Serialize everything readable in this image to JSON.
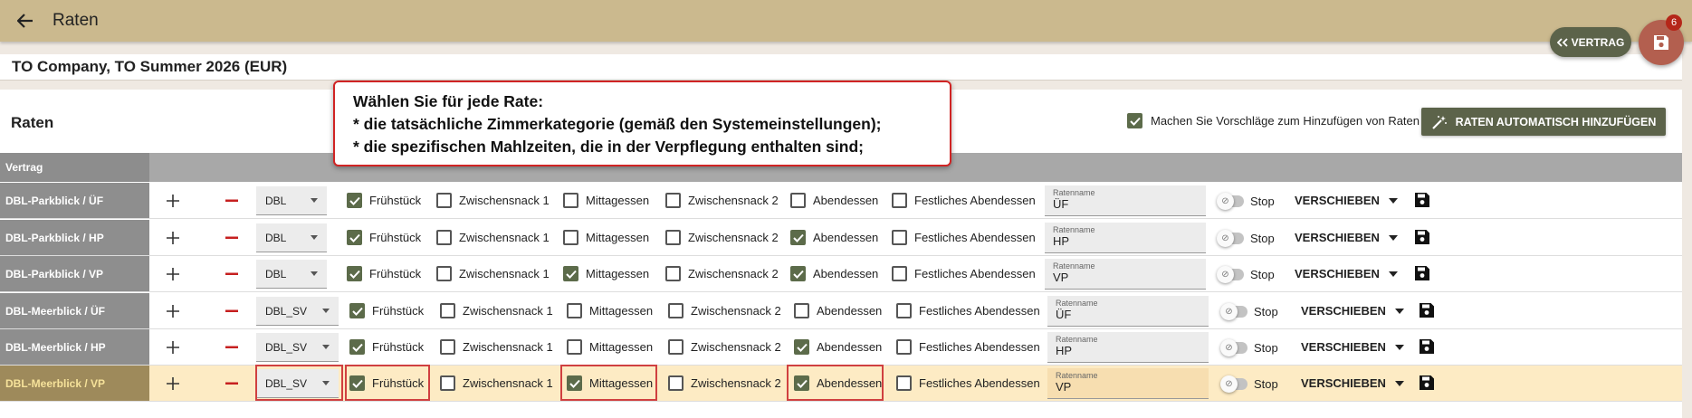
{
  "app": {
    "title": "Raten"
  },
  "contract": {
    "title": "TO Company, TO Summer 2026 (EUR)"
  },
  "fab": {
    "vertrag_label": "VERTRAG",
    "save_badge": "6"
  },
  "section": {
    "title": "Raten",
    "suggest_label": "Machen Sie Vorschläge zum Hinzufügen von Raten",
    "suggest_checked": true,
    "auto_add_label": "RATEN AUTOMATISCH HINZUFÜGEN"
  },
  "table": {
    "header_vertrag": "Vertrag",
    "name_field_label": "Ratenname",
    "stop_label": "Stop",
    "move_label": "VERSCHIEBEN",
    "meal_labels": [
      "Frühstück",
      "Zwischensnack 1",
      "Mittagessen",
      "Zwischensnack 2",
      "Abendessen",
      "Festliches Abendessen"
    ],
    "rows": [
      {
        "label": "DBL-Parkblick / ÜF",
        "room": "DBL",
        "meals": [
          true,
          false,
          false,
          false,
          false,
          false
        ],
        "name": "ÜF",
        "selected": false
      },
      {
        "label": "DBL-Parkblick / HP",
        "room": "DBL",
        "meals": [
          true,
          false,
          false,
          false,
          true,
          false
        ],
        "name": "HP",
        "selected": false
      },
      {
        "label": "DBL-Parkblick / VP",
        "room": "DBL",
        "meals": [
          true,
          false,
          true,
          false,
          true,
          false
        ],
        "name": "VP",
        "selected": false
      },
      {
        "label": "DBL-Meerblick / ÜF",
        "room": "DBL_SV",
        "meals": [
          true,
          false,
          false,
          false,
          false,
          false
        ],
        "name": "ÜF",
        "selected": false
      },
      {
        "label": "DBL-Meerblick / HP",
        "room": "DBL_SV",
        "meals": [
          true,
          false,
          false,
          false,
          true,
          false
        ],
        "name": "HP",
        "selected": false
      },
      {
        "label": "DBL-Meerblick / VP",
        "room": "DBL_SV",
        "meals": [
          true,
          false,
          true,
          false,
          true,
          false
        ],
        "name": "VP",
        "selected": true
      }
    ]
  },
  "tooltip": {
    "lines": [
      "Wählen Sie für jede Rate:",
      "* die tatsächliche Zimmerkategorie (gemäß den Systemeinstellungen);",
      "* die spezifischen Mahlzeiten, die in der Verpflegung enthalten sind;"
    ]
  },
  "colors": {
    "topbar": "#cbb98e",
    "accent": "#5c634a",
    "fab": "#b35f4f",
    "selected_row": "#fdebc4",
    "highlight": "#d04040"
  }
}
